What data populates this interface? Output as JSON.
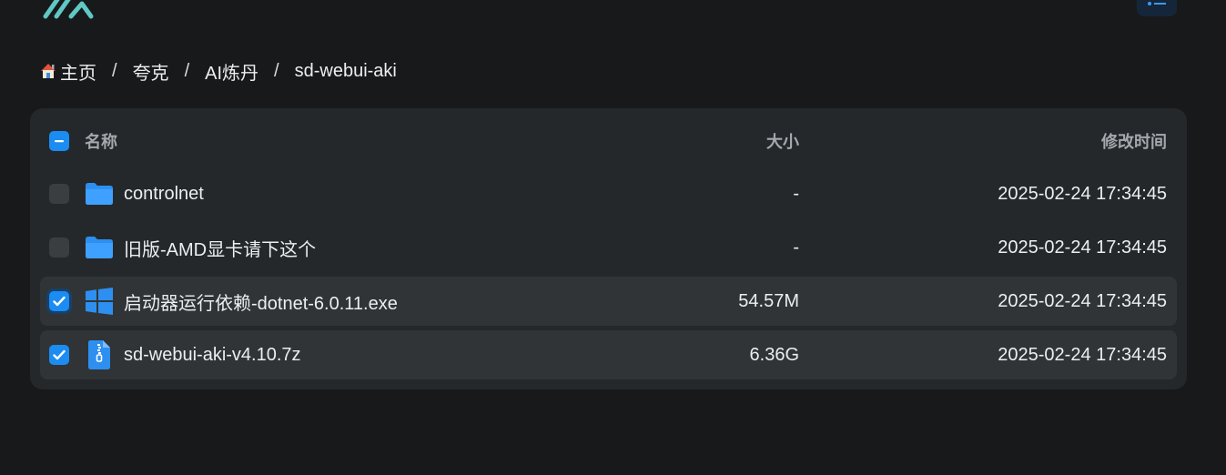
{
  "header": {
    "logo_icon": "app-logo-icon",
    "menu_icon": "list-menu-icon"
  },
  "breadcrumb": {
    "items": [
      "主页",
      "夸克",
      "AI炼丹",
      "sd-webui-aki"
    ],
    "separator": "/",
    "home_icon": "house-icon"
  },
  "table": {
    "columns": {
      "name": "名称",
      "size": "大小",
      "modified": "修改时间"
    },
    "header_checkbox_state": "indeterminate",
    "rows": [
      {
        "name": "controlnet",
        "size": "-",
        "modified": "2025-02-24 17:34:45",
        "type": "folder",
        "icon": "folder-icon",
        "checked": false
      },
      {
        "name": "旧版-AMD显卡请下这个",
        "size": "-",
        "modified": "2025-02-24 17:34:45",
        "type": "folder",
        "icon": "folder-icon",
        "checked": false
      },
      {
        "name": "启动器运行依赖-dotnet-6.0.11.exe",
        "size": "54.57M",
        "modified": "2025-02-24 17:34:45",
        "type": "exe",
        "icon": "windows-icon",
        "checked": true
      },
      {
        "name": "sd-webui-aki-v4.10.7z",
        "size": "6.36G",
        "modified": "2025-02-24 17:34:45",
        "type": "archive",
        "icon": "zip-file-icon",
        "checked": true
      }
    ]
  },
  "colors": {
    "accent": "#1b8cf2",
    "background": "#18191b",
    "panel": "#25282a",
    "selected_row": "#303436"
  }
}
